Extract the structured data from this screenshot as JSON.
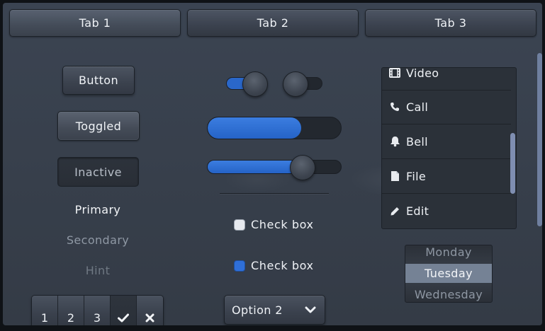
{
  "tabs": [
    {
      "label": "Tab 1",
      "selected": true
    },
    {
      "label": "Tab 2",
      "selected": false
    },
    {
      "label": "Tab 3",
      "selected": false
    }
  ],
  "buttons": {
    "button": "Button",
    "toggled": "Toggled",
    "inactive": "Inactive"
  },
  "labels": {
    "primary": "Primary",
    "secondary": "Secondary",
    "hint": "Hint"
  },
  "segmented": {
    "items": [
      "1",
      "2",
      "3"
    ],
    "confirm_icon": "check-icon",
    "cancel_icon": "close-icon"
  },
  "switches": {
    "first_on": true,
    "second_on": false
  },
  "progress": {
    "value": 0.7
  },
  "slider": {
    "value": 0.7
  },
  "checkboxes": [
    {
      "label": "Check box",
      "checked": false
    },
    {
      "label": "Check box",
      "checked": true
    }
  ],
  "dropdown": {
    "value": "Option 2",
    "icon": "chevron-down-icon"
  },
  "list": {
    "items": [
      {
        "label": "Video",
        "icon": "video-icon"
      },
      {
        "label": "Call",
        "icon": "phone-icon"
      },
      {
        "label": "Bell",
        "icon": "bell-icon"
      },
      {
        "label": "File",
        "icon": "file-icon"
      },
      {
        "label": "Edit",
        "icon": "edit-icon"
      }
    ]
  },
  "picker": {
    "items": [
      "Monday",
      "Tuesday",
      "Wednesday"
    ],
    "selected": "Tuesday"
  },
  "colors": {
    "accent": "#2a67c9",
    "background": "#373f4b",
    "list_background": "#2b3139",
    "picker_selected": "#758295"
  }
}
